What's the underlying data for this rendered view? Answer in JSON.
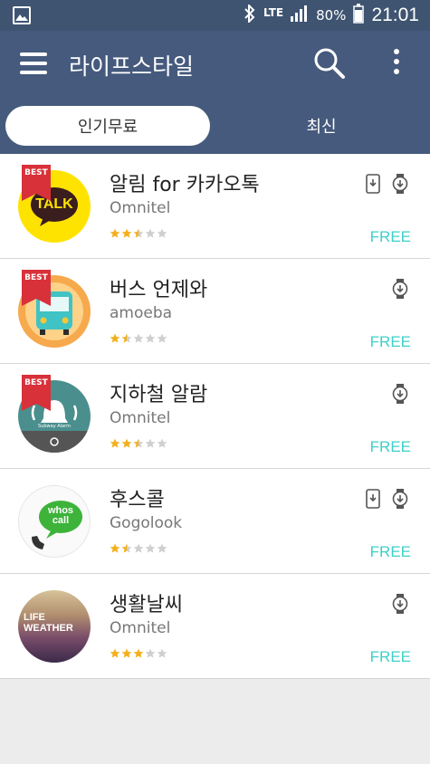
{
  "status_bar": {
    "network": "LTE",
    "battery": "80%",
    "time": "21:01"
  },
  "app_bar": {
    "title": "라이프스타일"
  },
  "tabs": [
    {
      "label": "인기무료",
      "selected": true
    },
    {
      "label": "최신",
      "selected": false
    }
  ],
  "apps": [
    {
      "name": "알림 for 카카오톡",
      "developer": "Omnitel",
      "price": "FREE",
      "rating": 2.5,
      "best": true,
      "phone": true,
      "watch": true,
      "icon_text": "TALK"
    },
    {
      "name": "버스 언제와",
      "developer": "amoeba",
      "price": "FREE",
      "rating": 1.5,
      "best": true,
      "phone": false,
      "watch": true
    },
    {
      "name": "지하철 알람",
      "developer": "Omnitel",
      "price": "FREE",
      "rating": 2.5,
      "best": true,
      "phone": false,
      "watch": true,
      "icon_text": "Subway Alarm"
    },
    {
      "name": "후스콜",
      "developer": "Gogolook",
      "price": "FREE",
      "rating": 1.5,
      "best": false,
      "phone": true,
      "watch": true,
      "icon_text": "whos call"
    },
    {
      "name": "생활날씨",
      "developer": "Omnitel",
      "price": "FREE",
      "rating": 3,
      "best": false,
      "phone": false,
      "watch": true,
      "icon_text": "LIFE WEATHER"
    }
  ],
  "best_label": "BEST",
  "colors": {
    "header": "#455a7c",
    "status": "#3f5471",
    "free": "#3fd0c9",
    "star": "#f2b01e"
  }
}
